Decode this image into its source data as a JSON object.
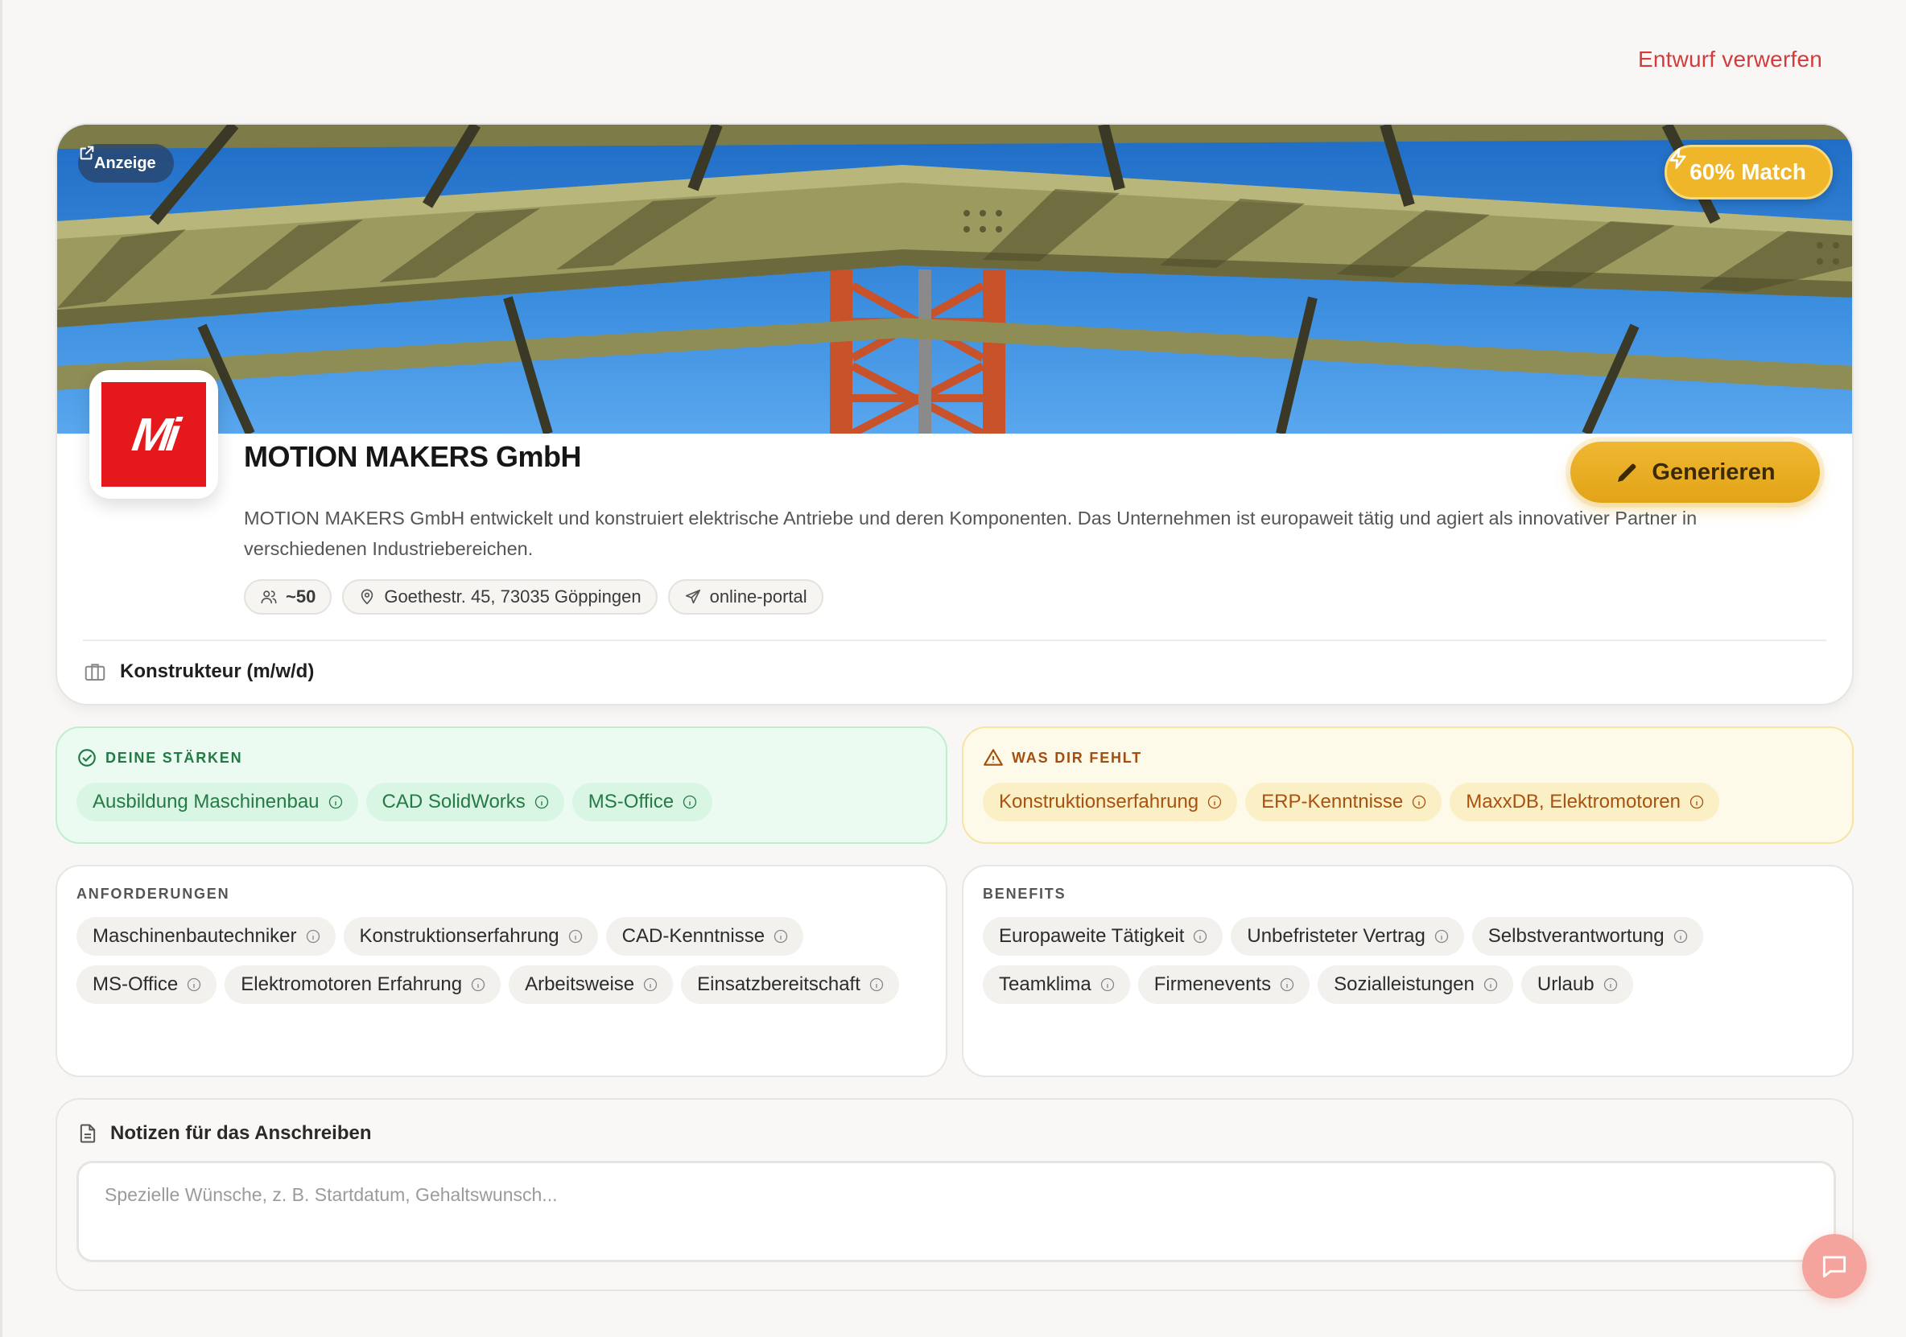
{
  "header": {
    "discard_label": "Entwurf verwerfen"
  },
  "company": {
    "ad_badge": "Anzeige",
    "match_label": "60% Match",
    "logo_text": "Mi",
    "name": "MOTION MAKERS GmbH",
    "generate_label": "Generieren",
    "description": "MOTION MAKERS GmbH entwickelt und konstruiert elektrische Antriebe und deren Komponenten. Das Unternehmen ist europaweit tätig und agiert als innovativer Partner in verschiedenen Industriebereichen.",
    "employees": "~50",
    "address": "Goethestr. 45, 73035 Göppingen",
    "application_channel": "online-portal",
    "job_title": "Konstrukteur (m/w/d)"
  },
  "strengths": {
    "title": "Deine Stärken",
    "tags": [
      "Ausbildung Maschinenbau",
      "CAD SolidWorks",
      "MS-Office"
    ]
  },
  "missing": {
    "title": "Was dir fehlt",
    "tags": [
      "Konstruktionserfahrung",
      "ERP-Kenntnisse",
      "MaxxDB, Elektromotoren"
    ]
  },
  "requirements": {
    "title": "Anforderungen",
    "tags": [
      "Maschinenbautechniker",
      "Konstruktionserfahrung",
      "CAD-Kenntnisse",
      "MS-Office",
      "Elektromotoren Erfahrung",
      "Arbeitsweise",
      "Einsatzbereitschaft"
    ]
  },
  "benefits": {
    "title": "Benefits",
    "tags": [
      "Europaweite Tätigkeit",
      "Unbefristeter Vertrag",
      "Selbstverantwortung",
      "Teamklima",
      "Firmenevents",
      "Sozialleistungen",
      "Urlaub"
    ]
  },
  "notes": {
    "title": "Notizen für das Anschreiben",
    "placeholder": "Spezielle Wünsche, z. B. Startdatum, Gehaltswunsch...",
    "value": ""
  },
  "icons": {
    "external": "external-link-icon",
    "bolt": "lightning-icon",
    "pencil": "pencil-icon",
    "users": "users-icon",
    "pin": "map-pin-icon",
    "send": "send-icon",
    "briefcase": "briefcase-icon",
    "check": "check-circle-icon",
    "warning": "warning-icon",
    "info": "info-icon",
    "doc": "document-icon",
    "chat": "chat-icon"
  },
  "colors": {
    "accent": "#e2a417",
    "danger": "#d23c3c",
    "success": "#257a45",
    "warning": "#a8520f"
  }
}
